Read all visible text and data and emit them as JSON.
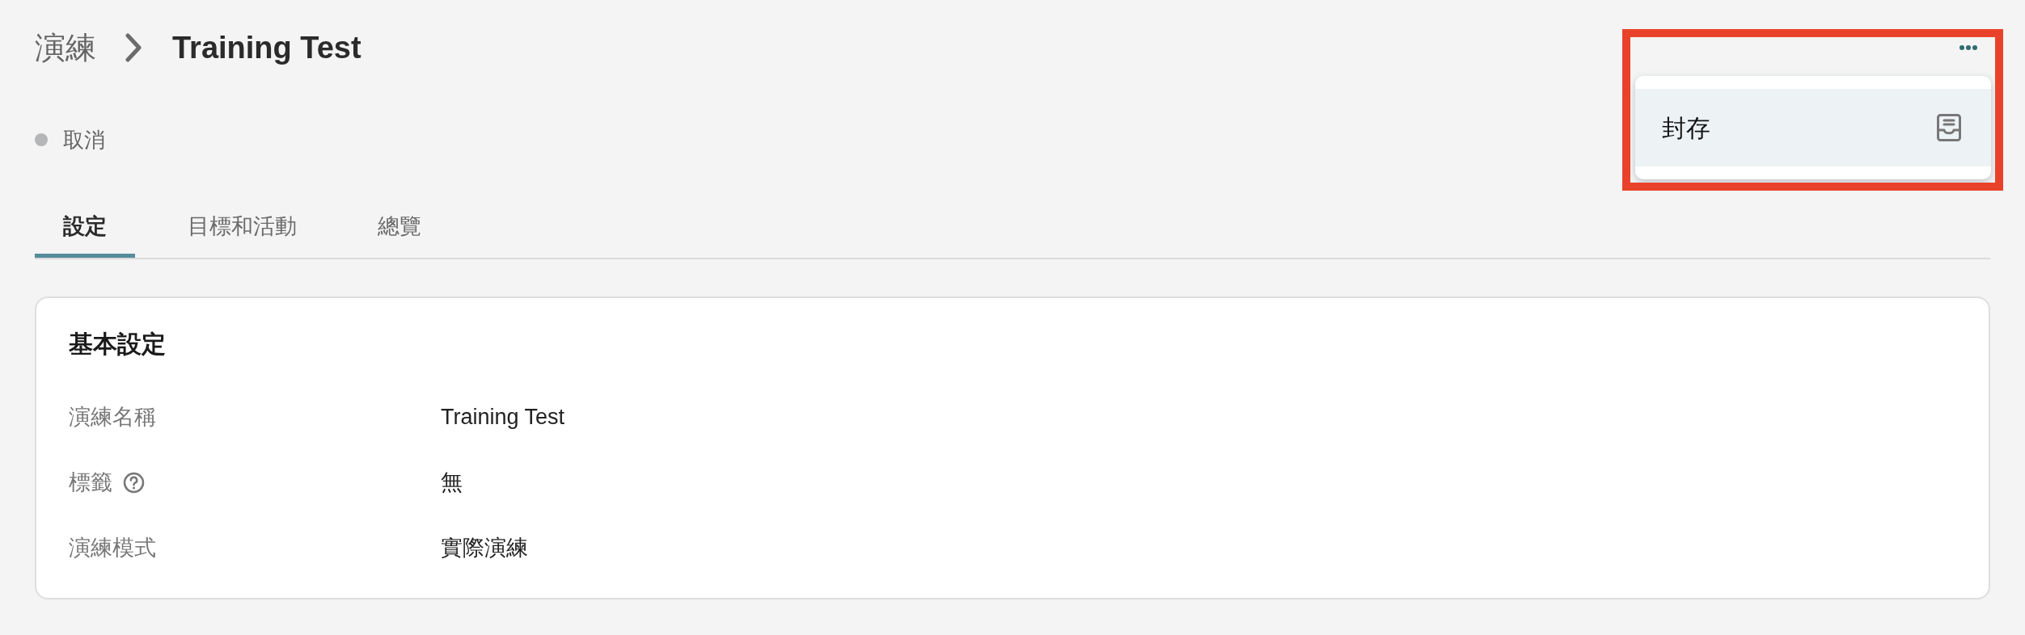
{
  "breadcrumb": {
    "parent": "演練",
    "current": "Training Test"
  },
  "status": {
    "label": "取消",
    "color": "#b4b6b8"
  },
  "tabs": [
    {
      "label": "設定",
      "selected": true
    },
    {
      "label": "目標和活動",
      "selected": false
    },
    {
      "label": "總覽",
      "selected": false
    }
  ],
  "card": {
    "title": "基本設定",
    "fields": [
      {
        "label": "演練名稱",
        "value": "Training Test",
        "help": false
      },
      {
        "label": "標籤",
        "value": "無",
        "help": true
      },
      {
        "label": "演練模式",
        "value": "實際演練",
        "help": false
      }
    ]
  },
  "menu": {
    "items": [
      {
        "label": "封存",
        "highlighted": true
      }
    ]
  }
}
